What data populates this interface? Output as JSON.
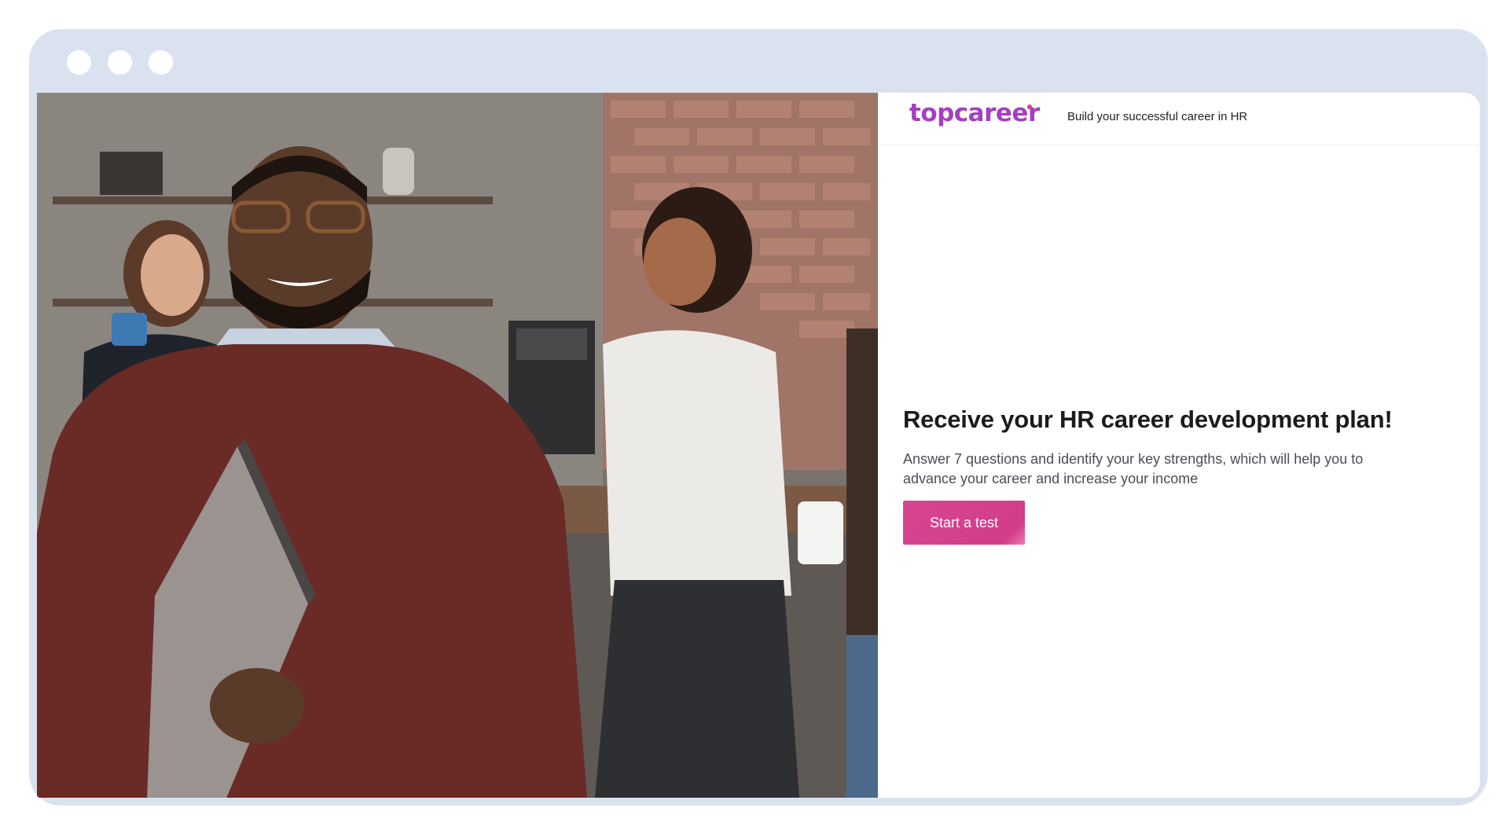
{
  "header": {
    "logo_text": "topcareer",
    "tagline": "Build your successful career in HR"
  },
  "hero": {
    "title": "Receive your HR career development plan!",
    "description": "Answer 7 questions and identify your key strengths, which will help you to advance your career and increase your income",
    "cta_label": "Start a test"
  },
  "colors": {
    "brand_purple": "#a43fc2",
    "cta_pink": "#d8468f",
    "frame": "#dbe2ef"
  },
  "icons": [
    "window-close-dot",
    "window-minimize-dot",
    "window-maximize-dot"
  ]
}
